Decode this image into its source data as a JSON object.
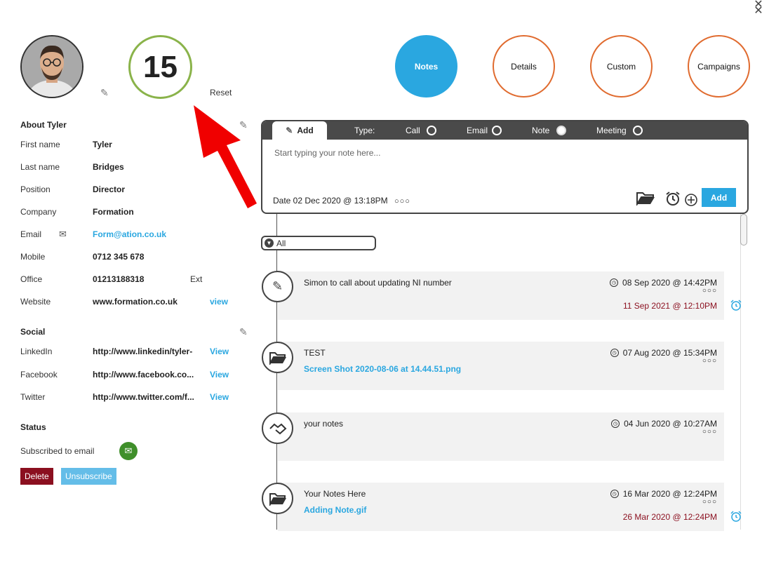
{
  "header": {
    "score": "15",
    "reset_label": "Reset"
  },
  "tabs": [
    {
      "label": "Notes",
      "active": true
    },
    {
      "label": "Details",
      "active": false
    },
    {
      "label": "Custom",
      "active": false
    },
    {
      "label": "Campaigns",
      "active": false
    }
  ],
  "about": {
    "title": "About Tyler",
    "first_name_label": "First name",
    "first_name": "Tyler",
    "last_name_label": "Last name",
    "last_name": "Bridges",
    "position_label": "Position",
    "position": "Director",
    "company_label": "Company",
    "company": "Formation",
    "email_label": "Email",
    "email": "Form@ation.co.uk",
    "mobile_label": "Mobile",
    "mobile": "0712 345 678",
    "office_label": "Office",
    "office": "01213188318",
    "ext_label": "Ext",
    "website_label": "Website",
    "website": "www.formation.co.uk",
    "view_label": "view"
  },
  "social": {
    "title": "Social",
    "linkedin_label": "LinkedIn",
    "linkedin": "http://www.linkedin/tyler-",
    "facebook_label": "Facebook",
    "facebook": "http://www.facebook.co...",
    "twitter_label": "Twitter",
    "twitter": "http://www.twitter.com/f...",
    "view_label": "View"
  },
  "status": {
    "title": "Status",
    "subscribed_label": "Subscribed to email",
    "delete_label": "Delete",
    "unsubscribe_label": "Unsubscribe"
  },
  "composer": {
    "add_tab": "Add",
    "type_label": "Type:",
    "types": [
      "Call",
      "Email",
      "Note",
      "Meeting"
    ],
    "selected_type": "Note",
    "placeholder": "Start typing your note here...",
    "date": "Date 02 Dec 2020 @ 13:18PM",
    "dots": "○○○",
    "add_button": "Add"
  },
  "filter": {
    "value": "All"
  },
  "notes": [
    {
      "icon": "pencil-icon",
      "title": "Simon to call about updating NI number",
      "file": "",
      "date": "08 Sep 2020 @ 14:42PM",
      "reminder": "11 Sep 2021 @ 12:10PM"
    },
    {
      "icon": "folder-icon",
      "title": "TEST",
      "file": "Screen Shot 2020-08-06 at 14.44.51.png",
      "date": "07 Aug 2020 @ 15:34PM",
      "reminder": ""
    },
    {
      "icon": "handshake-icon",
      "title": "your notes",
      "file": "",
      "date": "04 Jun 2020 @ 10:27AM",
      "reminder": ""
    },
    {
      "icon": "folder-icon",
      "title": "Your Notes Here",
      "file": "Adding Note.gif",
      "date": "16 Mar 2020 @ 12:24PM",
      "reminder": "26 Mar 2020 @ 12:24PM"
    }
  ],
  "dots": "○○○",
  "colors": {
    "accent": "#2aa7e0",
    "score_ring": "#8ab34a",
    "tab_ring": "#e06b2f",
    "delete": "#8b0f1f",
    "arrow": "#f00000"
  }
}
